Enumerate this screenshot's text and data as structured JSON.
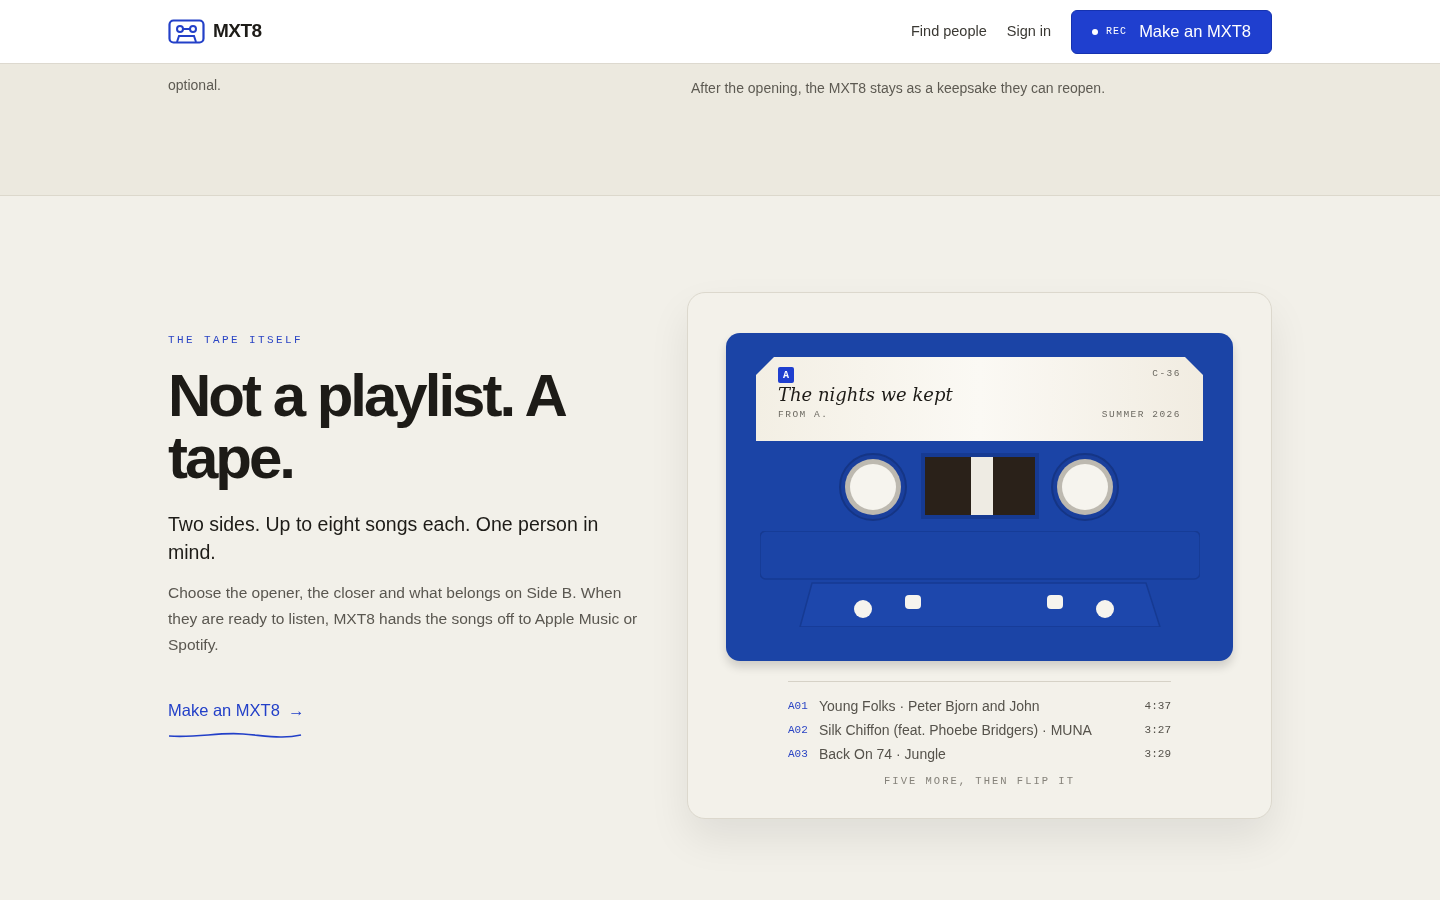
{
  "nav": {
    "brand": "MXT8",
    "links": [
      "Find people",
      "Sign in"
    ],
    "cta": {
      "rec": "REC",
      "label": "Make an MXT8"
    }
  },
  "top_band": {
    "left_text": "optional.",
    "right_text": "After the opening, the MXT8 stays as a keepsake they can reopen."
  },
  "section": {
    "eyebrow": "THE TAPE ITSELF",
    "heading": "Not a playlist. A tape.",
    "subheading": "Two sides. Up to eight songs each. One person in mind.",
    "body": "Choose the opener, the closer and what belongs on Side B. When they are ready to listen, MXT8 hands the songs off to Apple Music or Spotify.",
    "link": "Make an MXT8",
    "arrow": "→"
  },
  "tape": {
    "side": "A",
    "type": "C-36",
    "title": "The nights we kept",
    "from": "FROM A.",
    "date": "SUMMER 2026",
    "tracks": [
      {
        "code": "A01",
        "title": "Young Folks · Peter Bjorn and John",
        "time": "4:37"
      },
      {
        "code": "A02",
        "title": "Silk Chiffon (feat. Phoebe Bridgers) · MUNA",
        "time": "3:27"
      },
      {
        "code": "A03",
        "title": "Back On 74 · Jungle",
        "time": "3:29"
      }
    ],
    "footer": "FIVE MORE, THEN FLIP IT"
  }
}
